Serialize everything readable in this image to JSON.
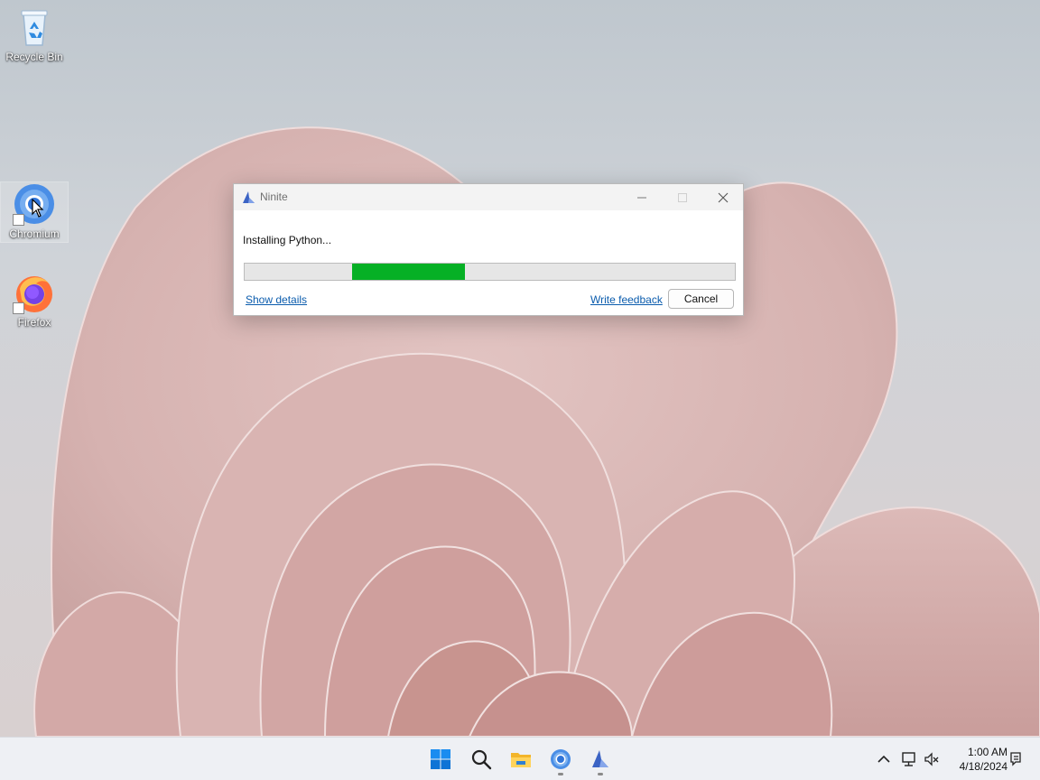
{
  "desktop": {
    "icons": [
      {
        "label": "Recycle Bin"
      },
      {
        "label": "Chromium"
      },
      {
        "label": "Firefox"
      }
    ]
  },
  "window": {
    "title": "Ninite",
    "status": "Installing Python...",
    "progress": {
      "start_fraction": 0.22,
      "end_fraction": 0.45
    },
    "show_details": "Show details",
    "write_feedback": "Write feedback",
    "cancel": "Cancel"
  },
  "taskbar": {
    "apps": [
      "start-icon",
      "search-icon",
      "file-explorer-icon",
      "chromium-icon",
      "ninite-icon"
    ],
    "time": "1:00 AM",
    "date": "4/18/2024"
  },
  "colors": {
    "progress": "#06b025",
    "link": "#0b5cad"
  }
}
